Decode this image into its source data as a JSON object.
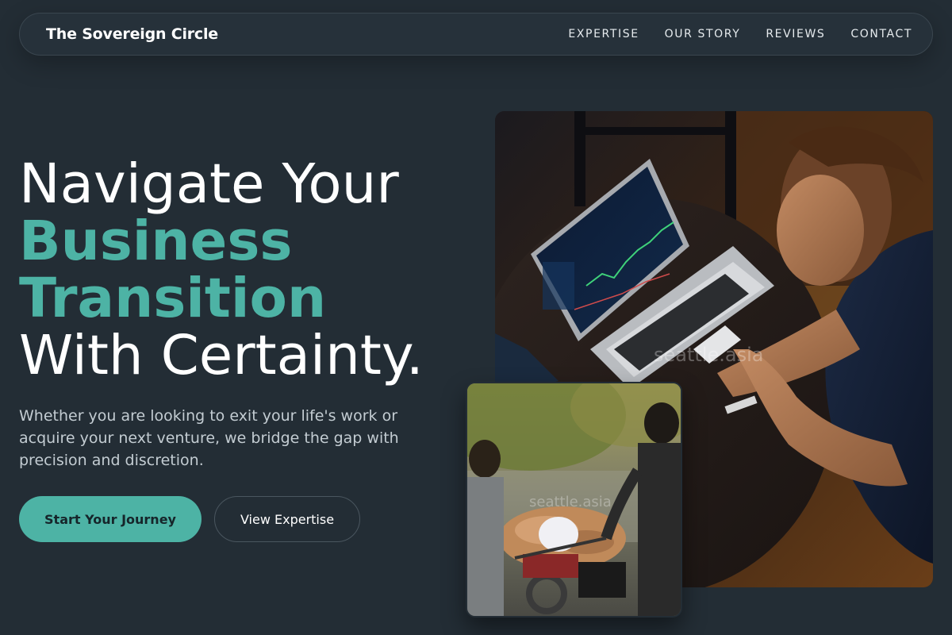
{
  "nav": {
    "brand": "The Sovereign Circle",
    "links": [
      "EXPERTISE",
      "OUR STORY",
      "REVIEWS",
      "CONTACT"
    ]
  },
  "hero": {
    "title_line1": "Navigate Your",
    "title_line2": "Business",
    "title_line3": "Transition",
    "title_line4": "With Certainty.",
    "subtitle": "Whether you are looking to exit your life's work or acquire your next venture, we bridge the gap with precision and discretion.",
    "primary_cta": "Start Your Journey",
    "secondary_cta": "View Expertise"
  },
  "images": {
    "main_watermark": "seattle.asia",
    "small_watermark": "seattle.asia"
  },
  "colors": {
    "background": "#232d35",
    "accent": "#4db3a5",
    "nav_bg": "#26313a"
  }
}
